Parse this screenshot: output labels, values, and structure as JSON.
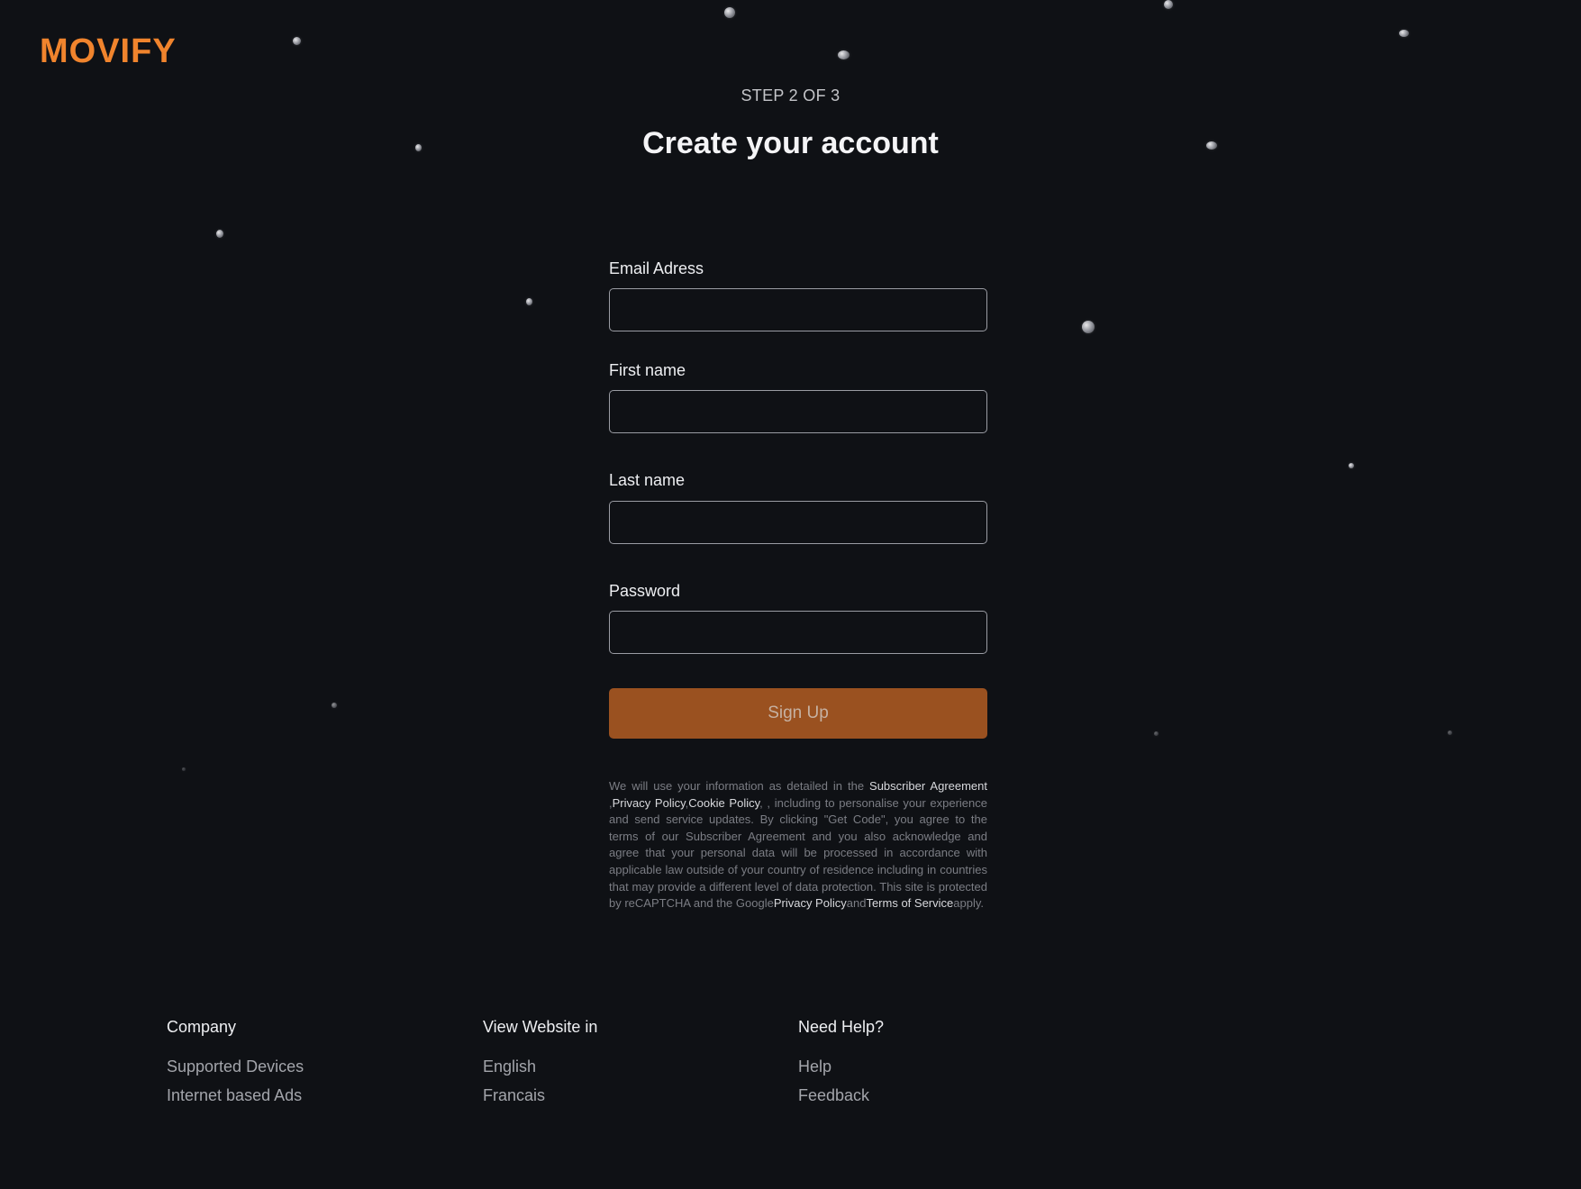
{
  "brand": {
    "name": "MOVIFY",
    "color": "#f0842d"
  },
  "header": {
    "step": "STEP 2 OF 3",
    "title": "Create your account"
  },
  "form": {
    "email_label": "Email Adress",
    "email_value": "",
    "first_name_label": "First name",
    "first_name_value": "",
    "last_name_label": "Last name",
    "last_name_value": "",
    "password_label": "Password",
    "password_value": "",
    "submit_label": "Sign Up",
    "submit_color": "#9a5120"
  },
  "legal": {
    "intro": "We will use your information as detailed in the ",
    "link_subscriber": "Subscriber Agreement",
    "sep1": " ,",
    "link_privacy": "Privacy Policy",
    "sep2": ",",
    "link_cookie": "Cookie Policy",
    "body": ", , including to personalise your experience and send service updates. By clicking \"Get Code\", you agree to the terms of our Subscriber Agreement and you also acknowledge and agree that your personal data will be processed in accordance with applicable law outside of your country of residence including in countries that may provide a different level of data protection. This site is protected by reCAPTCHA and the Google",
    "link_google_privacy": "Privacy Policy",
    "and": "and",
    "link_terms": "Terms of Service",
    "apply": "apply."
  },
  "footer": {
    "company": {
      "heading": "Company",
      "links": [
        "Supported Devices",
        "Internet based Ads"
      ]
    },
    "language": {
      "heading": "View Website in",
      "links": [
        "English",
        "Francais"
      ]
    },
    "help": {
      "heading": "Need Help?",
      "links": [
        "Help",
        "Feedback"
      ]
    }
  },
  "background": {
    "color": "#0f1115",
    "decoration": "star-particle-icon"
  }
}
